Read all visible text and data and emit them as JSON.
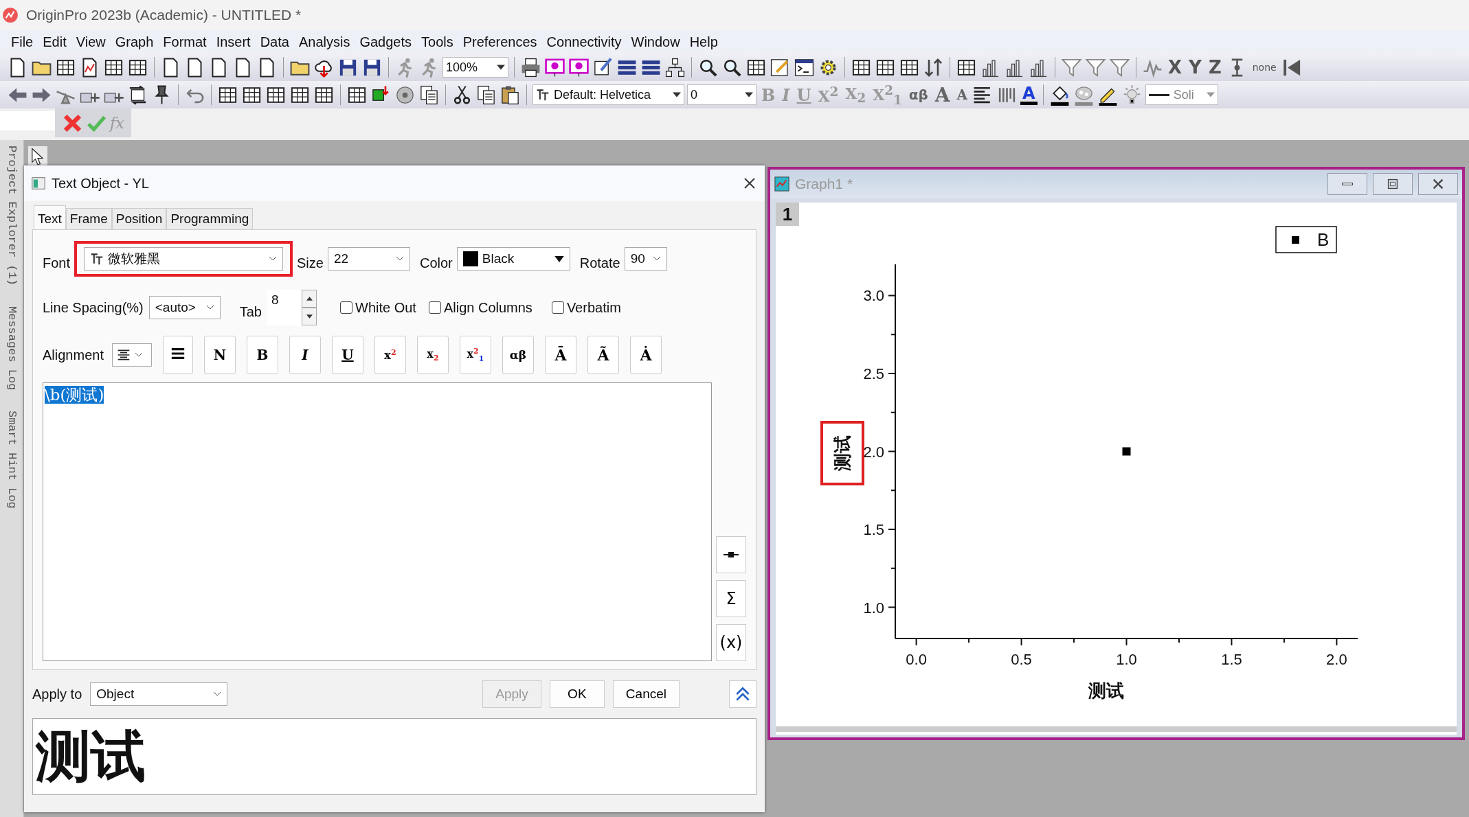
{
  "window": {
    "title": "OriginPro 2023b (Academic) - UNTITLED *"
  },
  "menu": [
    "File",
    "Edit",
    "View",
    "Graph",
    "Format",
    "Insert",
    "Data",
    "Analysis",
    "Gadgets",
    "Tools",
    "Preferences",
    "Connectivity",
    "Window",
    "Help"
  ],
  "toolbar_1": {
    "zoom": "100%",
    "axis_buttons": [
      "X",
      "Y",
      "Z"
    ],
    "none_button": "none"
  },
  "toolbar_2": {
    "font": "Default: Helvetica",
    "size": "0",
    "style_buttons": [
      {
        "label": "B",
        "disabled": true
      },
      {
        "label": "I",
        "disabled": true
      },
      {
        "label": "U",
        "disabled": true
      },
      {
        "label": "X$^{2}$",
        "disabled": true
      },
      {
        "label": "X$_{2}$",
        "disabled": true
      },
      {
        "label": "X$^{2}$$_{1}$",
        "disabled": true
      },
      {
        "label": "αβ",
        "disabled": false
      },
      {
        "label": "A",
        "disabled": false
      },
      {
        "label": "A",
        "disabled": false
      }
    ],
    "font_color_button": "A",
    "line_style": "Soli"
  },
  "formula_bar": {
    "function_label": "fx"
  },
  "side_panels": [
    "Project Explorer (1)",
    "Messages Log",
    "Smart Hint Log"
  ],
  "dialog": {
    "title": "Text Object - YL",
    "tabs": [
      {
        "label": "Text",
        "selected": true
      },
      {
        "label": "Frame",
        "selected": false
      },
      {
        "label": "Position",
        "selected": false
      },
      {
        "label": "Programming",
        "selected": false
      }
    ],
    "font": {
      "label": "Font",
      "value": "微软雅黑",
      "highlighted": true
    },
    "size": {
      "label": "Size",
      "value": "22"
    },
    "color": {
      "label": "Color",
      "value": "Black",
      "color": "#000000"
    },
    "rotate": {
      "label": "Rotate",
      "value": "90"
    },
    "line_spacing": {
      "label": "Line Spacing(%)",
      "value": "<auto>"
    },
    "tab": {
      "label": "Tab",
      "value": "8"
    },
    "options": [
      {
        "label": "White Out",
        "checked": false
      },
      {
        "label": "Align Columns",
        "checked": false
      },
      {
        "label": "Verbatim",
        "checked": false
      }
    ],
    "alignment": {
      "label": "Alignment"
    },
    "format_buttons": [
      "N",
      "B",
      "I",
      "U",
      "x$^{2}$",
      "x$_{2}$",
      "x$^{2}$$_{1}$",
      "αβ",
      "Ā",
      "Ã",
      "Ȧ"
    ],
    "text": "\\b(测试)",
    "side_buttons": [
      "Σ",
      "(x)"
    ],
    "apply_to": {
      "label": "Apply to",
      "value": "Object"
    },
    "buttons": [
      {
        "label": "Apply",
        "disabled": true
      },
      {
        "label": "OK",
        "disabled": false
      },
      {
        "label": "Cancel",
        "disabled": false
      }
    ],
    "preview": "测试"
  },
  "graph": {
    "title": "Graph1 *",
    "layer": "1",
    "y_title_highlighted": true,
    "chart_data": {
      "type": "scatter",
      "xlabel": "测试",
      "ylabel": "测试",
      "x": [
        1
      ],
      "series": [
        {
          "name": "B",
          "color": "#000000",
          "values": [
            2
          ]
        }
      ],
      "xlim": [
        -0.1,
        2.1
      ],
      "ylim": [
        0.8,
        3.2
      ],
      "xticks": [
        {
          "value": 0,
          "label": "0.0"
        },
        {
          "value": 0.5,
          "label": "0.5"
        },
        {
          "value": 1,
          "label": "1.0"
        },
        {
          "value": 1.5,
          "label": "1.5"
        },
        {
          "value": 2,
          "label": "2.0"
        }
      ],
      "yticks": [
        {
          "value": 1,
          "label": "1.0"
        },
        {
          "value": 1.5,
          "label": "1.5"
        },
        {
          "value": 2,
          "label": "2.0"
        },
        {
          "value": 2.5,
          "label": "2.5"
        },
        {
          "value": 3,
          "label": "3.0"
        }
      ]
    }
  }
}
